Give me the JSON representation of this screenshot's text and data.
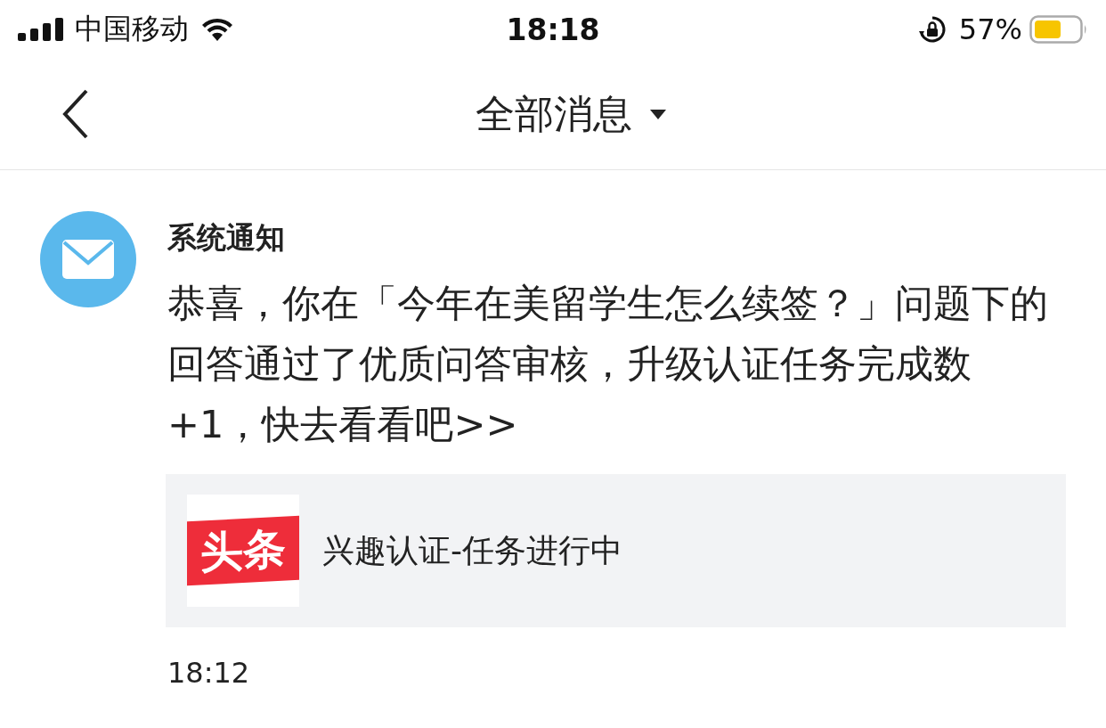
{
  "status_bar": {
    "carrier": "中国移动",
    "time": "18:18",
    "battery": "57%"
  },
  "nav": {
    "title": "全部消息"
  },
  "message": {
    "sender": "系统通知",
    "body": "恭喜，你在「今年在美留学生怎么续签？」问题下的回答通过了优质问答审核，升级认证任务完成数 +1，快去看看吧>>",
    "card": {
      "logo_text": "头条",
      "title": "兴趣认证-任务进行中"
    },
    "time": "18:12"
  }
}
